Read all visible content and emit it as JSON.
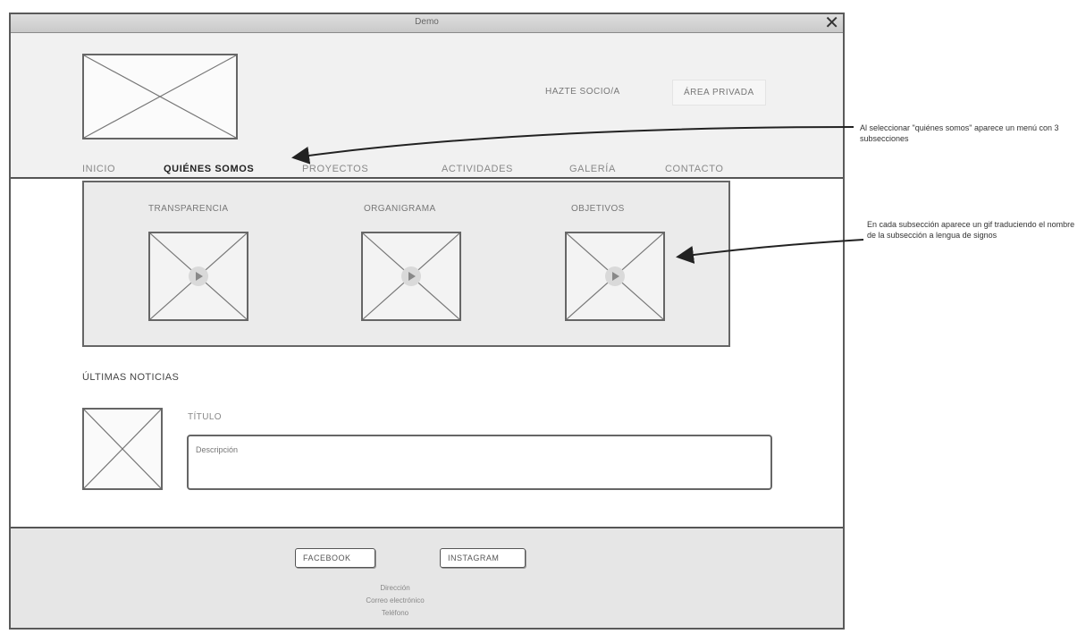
{
  "window": {
    "title": "Demo"
  },
  "header": {
    "hazte_label": "HAZTE SOCIO/A",
    "area_label": "ÁREA PRIVADA"
  },
  "nav": {
    "items": [
      {
        "label": "INICIO"
      },
      {
        "label": "QUIÉNES SOMOS"
      },
      {
        "label": "PROYECTOS"
      },
      {
        "label": "ACTIVIDADES"
      },
      {
        "label": "GALERÍA"
      },
      {
        "label": "CONTACTO"
      }
    ]
  },
  "submenu": {
    "items": [
      {
        "label": "TRANSPARENCIA"
      },
      {
        "label": "ORGANIGRAMA"
      },
      {
        "label": "OBJETIVOS"
      }
    ]
  },
  "news": {
    "heading": "ÚLTIMAS NOTICIAS",
    "title": "TÍTULO",
    "description": "Descripción"
  },
  "footer": {
    "facebook_label": "FACEBOOK",
    "instagram_label": "INSTAGRAM",
    "lines": [
      "Dirección",
      "Correo electrónico",
      "Teléfono"
    ]
  },
  "annotations": {
    "note1": "Al seleccionar \"quiénes somos\" aparece un menú con 3 subsecciones",
    "note2": "En cada subsección aparece un gif traduciendo el nombre de la subsección a lengua de signos"
  }
}
